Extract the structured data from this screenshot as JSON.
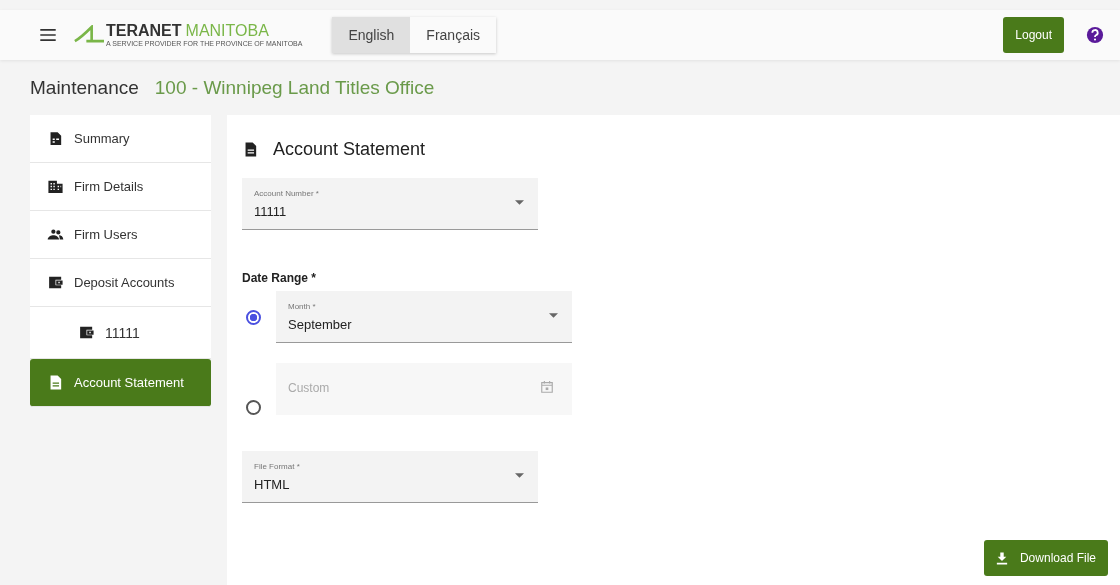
{
  "header": {
    "logo": {
      "brand": "TERANET",
      "region": "MANITOBA",
      "tagline": "A SERVICE PROVIDER FOR THE PROVINCE OF MANITOBA"
    },
    "languages": [
      {
        "label": "English",
        "selected": true
      },
      {
        "label": "Français",
        "selected": false
      }
    ],
    "logout": "Logout"
  },
  "page": {
    "title": "Maintenance",
    "office": "100 - Winnipeg Land Titles Office"
  },
  "sidebar": {
    "items": [
      {
        "label": "Summary",
        "kind": "summary",
        "selected": false
      },
      {
        "label": "Firm Details",
        "kind": "building",
        "selected": false
      },
      {
        "label": "Firm Users",
        "kind": "users",
        "selected": false
      },
      {
        "label": "Deposit Accounts",
        "kind": "wallet",
        "selected": false,
        "children": [
          {
            "label": "11111",
            "kind": "wallet",
            "selected": false
          }
        ]
      },
      {
        "label": "Account Statement",
        "kind": "document",
        "selected": true
      }
    ]
  },
  "form": {
    "title": "Account Statement",
    "account": {
      "label": "Account Number *",
      "value": "11111"
    },
    "date_range": {
      "label": "Date Range *",
      "options": [
        {
          "kind": "month",
          "selected": true,
          "label": "Month *",
          "value": "September"
        },
        {
          "kind": "custom",
          "selected": false,
          "placeholder": "Custom"
        }
      ]
    },
    "file_format": {
      "label": "File Format *",
      "value": "HTML"
    },
    "download": "Download File"
  }
}
